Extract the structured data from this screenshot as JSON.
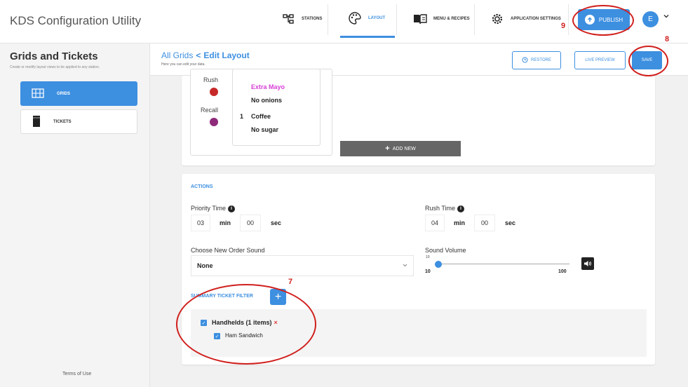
{
  "app": {
    "title": "KDS Configuration Utility"
  },
  "nav": {
    "stations": "STATIONS",
    "layout": "LAYOUT",
    "menu": "MENU & RECIPES",
    "settings": "APPLICATION SETTINGS",
    "publish": "PUBLISH",
    "avatar": "E"
  },
  "sidebar": {
    "title": "Grids and Tickets",
    "subtitle": "Create or modify layout views to be applied to any station.",
    "items": [
      {
        "label": "GRIDS"
      },
      {
        "label": "TICKETS"
      }
    ],
    "terms": "Terms of Use"
  },
  "header": {
    "crumb_all": "All Grids",
    "crumb_sep": "<",
    "crumb_current": "Edit Layout",
    "subtitle": "Here you can edit your data.",
    "restore": "RESTORE",
    "live_preview": "LIVE PREVIEW",
    "save": "SAVE"
  },
  "preview": {
    "legend": [
      {
        "label": "Rush",
        "color": "#c62828"
      },
      {
        "label": "Recall",
        "color": "#8e2a7a"
      }
    ],
    "ticket_lines": [
      {
        "qty": "",
        "text": "Extra Mayo",
        "color": "#d63fd6"
      },
      {
        "qty": "",
        "text": "No onions",
        "color": "#222222"
      },
      {
        "qty": "1",
        "text": "Coffee",
        "color": "#222222"
      },
      {
        "qty": "",
        "text": "No sugar",
        "color": "#222222"
      }
    ],
    "add_new": "ADD NEW"
  },
  "actions": {
    "title": "ACTIONS",
    "priority_time": {
      "label": "Priority Time",
      "min": "03",
      "min_unit": "min",
      "sec": "00",
      "sec_unit": "sec"
    },
    "rush_time": {
      "label": "Rush Time",
      "min": "04",
      "min_unit": "min",
      "sec": "00",
      "sec_unit": "sec"
    },
    "order_sound": {
      "label": "Choose New Order Sound",
      "value": "None"
    },
    "sound_volume": {
      "label": "Sound Volume",
      "value": "10",
      "min_label": "10",
      "max_label": "100",
      "level": 0.0
    },
    "summary_filter": {
      "title": "SUMMARY TICKET FILTER",
      "group": {
        "label": "Handhelds (1 items)",
        "remove": "×"
      },
      "items": [
        {
          "label": "Ham Sandwich"
        }
      ]
    }
  },
  "annotations": {
    "n7": "7",
    "n8": "8",
    "n9": "9",
    "color": "#d0201d"
  },
  "colors": {
    "accent": "#3d8fe0"
  }
}
